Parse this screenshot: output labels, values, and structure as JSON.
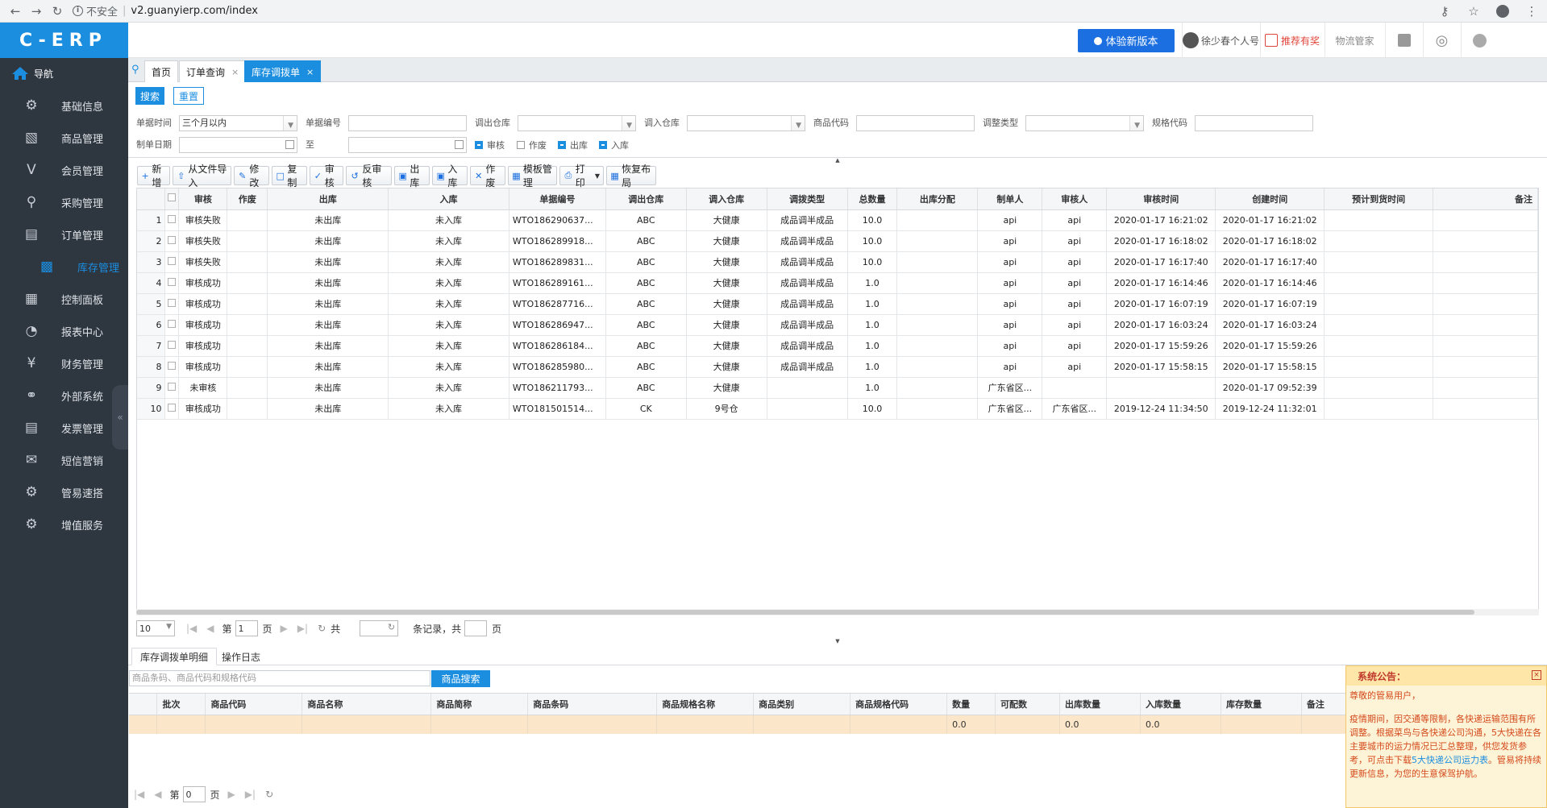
{
  "browser": {
    "security_label": "不安全",
    "url": "v2.guanyierp.com/index"
  },
  "sidebar": {
    "logo": "C-ERP",
    "nav_header": "导航",
    "items": [
      {
        "label": "基础信息",
        "icon": "gear-icon"
      },
      {
        "label": "商品管理",
        "icon": "store-icon"
      },
      {
        "label": "会员管理",
        "icon": "vip-icon"
      },
      {
        "label": "采购管理",
        "icon": "cart-icon"
      },
      {
        "label": "订单管理",
        "icon": "clipboard-icon"
      },
      {
        "label": "库存管理",
        "icon": "boxes-icon",
        "active": true
      },
      {
        "label": "控制面板",
        "icon": "grid-icon"
      },
      {
        "label": "报表中心",
        "icon": "pie-chart-icon"
      },
      {
        "label": "财务管理",
        "icon": "yen-icon"
      },
      {
        "label": "外部系统",
        "icon": "link-icon"
      },
      {
        "label": "发票管理",
        "icon": "invoice-icon"
      },
      {
        "label": "短信营销",
        "icon": "mail-icon"
      },
      {
        "label": "管易速搭",
        "icon": "gear-icon"
      },
      {
        "label": "增值服务",
        "icon": "gear-icon"
      }
    ]
  },
  "header": {
    "new_version": "体验新版本",
    "user": "徐少春个人号",
    "recommend": "推荐有奖",
    "logistics": "物流管家"
  },
  "tabs": [
    {
      "label": "首页"
    },
    {
      "label": "订单查询"
    },
    {
      "label": "库存调拨单",
      "active": true
    }
  ],
  "search": {
    "search_btn": "搜索",
    "reset_btn": "重置",
    "fields": {
      "doc_time_label": "单据时间",
      "doc_time_value": "三个月以内",
      "doc_no_label": "单据编号",
      "out_wh_label": "调出仓库",
      "in_wh_label": "调入仓库",
      "goods_code_label": "商品代码",
      "adjust_type_label": "调整类型",
      "spec_code_label": "规格代码",
      "create_date_label": "制单日期",
      "to_label": "至"
    },
    "checks": [
      {
        "label": "审核",
        "checked": true
      },
      {
        "label": "作废",
        "checked": false
      },
      {
        "label": "出库",
        "checked": true
      },
      {
        "label": "入库",
        "checked": true
      }
    ]
  },
  "toolbar": [
    {
      "label": "新增",
      "icon": "plus-icon"
    },
    {
      "label": "从文件导入",
      "icon": "import-icon"
    },
    {
      "label": "修改",
      "icon": "edit-icon"
    },
    {
      "label": "复制",
      "icon": "copy-icon"
    },
    {
      "label": "审核",
      "icon": "approve-icon"
    },
    {
      "label": "反审核",
      "icon": "unapprove-icon"
    },
    {
      "label": "出库",
      "icon": "truck-out-icon"
    },
    {
      "label": "入库",
      "icon": "truck-in-icon"
    },
    {
      "label": "作废",
      "icon": "cancel-icon"
    },
    {
      "label": "模板管理",
      "icon": "template-icon"
    },
    {
      "label": "打印",
      "icon": "printer-icon"
    },
    {
      "label": "恢复布局",
      "icon": "layout-icon"
    }
  ],
  "grid": {
    "columns": [
      "审核",
      "作废",
      "出库",
      "入库",
      "单据编号",
      "调出仓库",
      "调入仓库",
      "调拨类型",
      "总数量",
      "出库分配",
      "制单人",
      "审核人",
      "审核时间",
      "创建时间",
      "预计到货时间",
      "备注"
    ],
    "rows": [
      [
        "1",
        "审核失败",
        "",
        "未出库",
        "未入库",
        "WTO186290637...",
        "ABC",
        "大健康",
        "成品调半成品",
        "10.0",
        "",
        "api",
        "api",
        "2020-01-17 16:21:02",
        "2020-01-17 16:21:02",
        "",
        ""
      ],
      [
        "2",
        "审核失败",
        "",
        "未出库",
        "未入库",
        "WTO186289918...",
        "ABC",
        "大健康",
        "成品调半成品",
        "10.0",
        "",
        "api",
        "api",
        "2020-01-17 16:18:02",
        "2020-01-17 16:18:02",
        "",
        ""
      ],
      [
        "3",
        "审核失败",
        "",
        "未出库",
        "未入库",
        "WTO186289831...",
        "ABC",
        "大健康",
        "成品调半成品",
        "10.0",
        "",
        "api",
        "api",
        "2020-01-17 16:17:40",
        "2020-01-17 16:17:40",
        "",
        ""
      ],
      [
        "4",
        "审核成功",
        "",
        "未出库",
        "未入库",
        "WTO186289161...",
        "ABC",
        "大健康",
        "成品调半成品",
        "1.0",
        "",
        "api",
        "api",
        "2020-01-17 16:14:46",
        "2020-01-17 16:14:46",
        "",
        ""
      ],
      [
        "5",
        "审核成功",
        "",
        "未出库",
        "未入库",
        "WTO186287716...",
        "ABC",
        "大健康",
        "成品调半成品",
        "1.0",
        "",
        "api",
        "api",
        "2020-01-17 16:07:19",
        "2020-01-17 16:07:19",
        "",
        ""
      ],
      [
        "6",
        "审核成功",
        "",
        "未出库",
        "未入库",
        "WTO186286947...",
        "ABC",
        "大健康",
        "成品调半成品",
        "1.0",
        "",
        "api",
        "api",
        "2020-01-17 16:03:24",
        "2020-01-17 16:03:24",
        "",
        ""
      ],
      [
        "7",
        "审核成功",
        "",
        "未出库",
        "未入库",
        "WTO186286184...",
        "ABC",
        "大健康",
        "成品调半成品",
        "1.0",
        "",
        "api",
        "api",
        "2020-01-17 15:59:26",
        "2020-01-17 15:59:26",
        "",
        ""
      ],
      [
        "8",
        "审核成功",
        "",
        "未出库",
        "未入库",
        "WTO186285980...",
        "ABC",
        "大健康",
        "成品调半成品",
        "1.0",
        "",
        "api",
        "api",
        "2020-01-17 15:58:15",
        "2020-01-17 15:58:15",
        "",
        ""
      ],
      [
        "9",
        "未审核",
        "",
        "未出库",
        "未入库",
        "WTO186211793...",
        "ABC",
        "大健康",
        "",
        "1.0",
        "",
        "广东省区...",
        "",
        "",
        "2020-01-17 09:52:39",
        "",
        ""
      ],
      [
        "10",
        "审核成功",
        "",
        "未出库",
        "未入库",
        "WTO181501514...",
        "CK",
        "9号仓",
        "",
        "10.0",
        "",
        "广东省区...",
        "广东省区...",
        "2019-12-24 11:34:50",
        "2019-12-24 11:32:01",
        "",
        ""
      ]
    ]
  },
  "pager": {
    "page_size": "10",
    "page_label": "第",
    "page_value": "1",
    "page_unit": "页",
    "total_label": "共",
    "records_label": "条记录，共",
    "pages_unit": "页"
  },
  "detail": {
    "tabs": [
      {
        "label": "库存调拨单明细",
        "active": true
      },
      {
        "label": "操作日志"
      }
    ],
    "search_placeholder": "商品条码、商品代码和规格代码",
    "search_btn": "商品搜索",
    "columns": [
      "批次",
      "商品代码",
      "商品名称",
      "商品简称",
      "商品条码",
      "商品规格名称",
      "商品类别",
      "商品规格代码",
      "数量",
      "可配数",
      "出库数量",
      "入库数量",
      "库存数量",
      "备注"
    ],
    "totals": [
      "",
      "",
      "",
      "",
      "",
      "",
      "",
      "",
      "0.0",
      "",
      "0.0",
      "0.0",
      "",
      ""
    ],
    "pager_page_label": "第",
    "pager_page_value": "0",
    "pager_page_unit": "页"
  },
  "notice": {
    "title": "系统公告：",
    "greeting": "尊敬的管易用户，",
    "body_1": "疫情期间，因交通等限制，各快递运输范围有所调整。根据菜鸟与各快递公司沟通，5大快递在各主要城市的运力情况已汇总整理，供您发货参考，可点击下载",
    "link": "5大快递公司运力表",
    "body_2": "。管易将持续更新信息，为您的生意保驾护航。"
  }
}
